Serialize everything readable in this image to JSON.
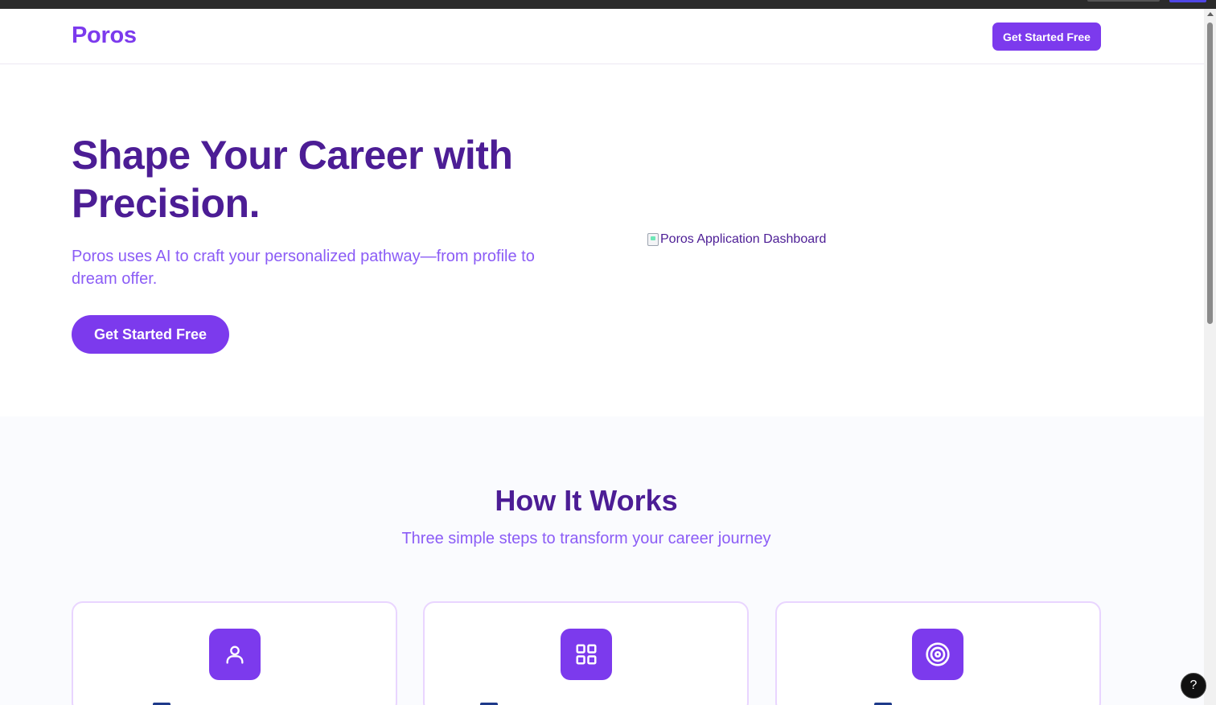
{
  "navbar": {
    "logo": "Poros",
    "cta_label": "Get Started Free"
  },
  "hero": {
    "title": "Shape Your Career with Precision.",
    "subtitle": "Poros uses AI to craft your personalized pathway—from profile to dream offer.",
    "cta_label": "Get Started Free",
    "image_alt": "Poros Application Dashboard"
  },
  "how_it_works": {
    "title": "How It Works",
    "subtitle": "Three simple steps to transform your career journey",
    "steps": [
      {
        "icon": "user-icon"
      },
      {
        "icon": "grid-icon"
      },
      {
        "icon": "target-icon"
      }
    ]
  },
  "help": {
    "label": "?"
  },
  "colors": {
    "brand": "#7c3aed",
    "heading": "#4c1d95",
    "subtext": "#8b5cf6",
    "section_bg": "#fafbfe",
    "card_border": "#e9d5ff"
  }
}
